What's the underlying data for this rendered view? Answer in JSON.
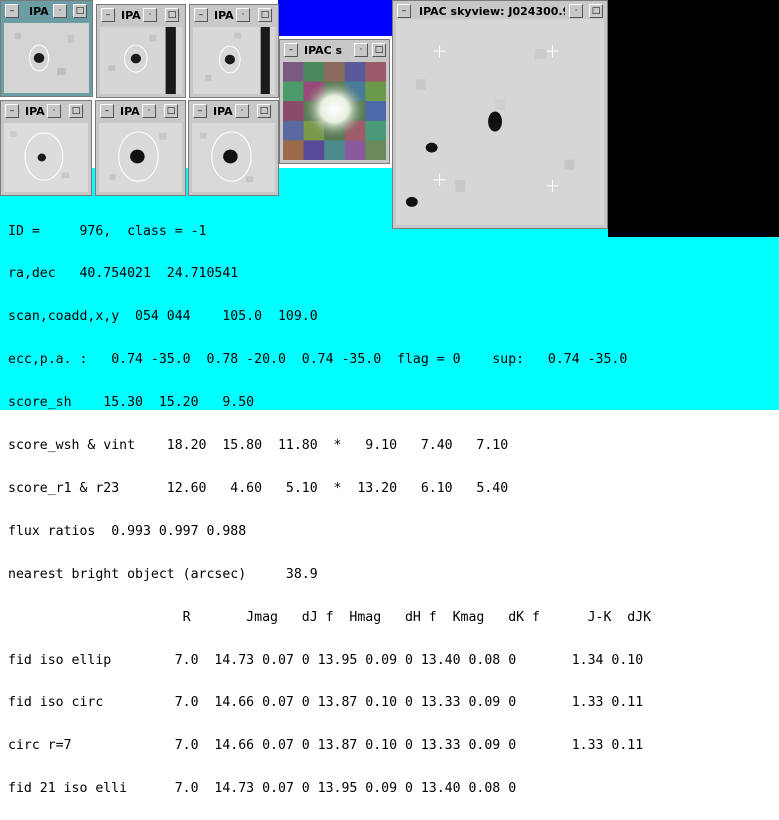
{
  "windows": {
    "thumb1_title": "IPA",
    "thumb2_title": "IPA",
    "thumb3_title": "IPA",
    "thumb4_title": "IPA",
    "thumb5_title": "IPA",
    "thumb6_title": "IPA",
    "color_title": "IPAC s",
    "skyview_title": "IPAC skyview: J024300.9"
  },
  "output": {
    "lines": [
      "ID =     976,  class = -1",
      "ra,dec   40.754021  24.710541",
      "scan,coadd,x,y  054 044    105.0  109.0",
      "ecc,p.a. :   0.74 -35.0  0.78 -20.0  0.74 -35.0  flag = 0    sup:   0.74 -35.0",
      "score_sh    15.30  15.20   9.50",
      "score_wsh & vint    18.20  15.80  11.80  *   9.10   7.40   7.10",
      "score_r1 & r23      12.60   4.60   5.10  *  13.20   6.10   5.40",
      "flux ratios  0.993 0.997 0.988",
      "nearest bright object (arcsec)     38.9",
      "                      R       Jmag   dJ f  Hmag   dH f  Kmag   dK f      J-K  dJK",
      "fid iso ellip        7.0  14.73 0.07 0 13.95 0.09 0 13.40 0.08 0       1.34 0.10",
      "fid iso circ         7.0  14.66 0.07 0 13.87 0.10 0 13.33 0.09 0       1.33 0.11",
      "circ r=7             7.0  14.66 0.07 0 13.87 0.10 0 13.33 0.09 0       1.33 0.11",
      "fid 21 iso elli      7.0  14.73 0.07 0 13.95 0.09 0 13.40 0.08 0"
    ]
  },
  "colors": {
    "terminal_bg": "#00ffff",
    "desktop_blue": "#0000ff",
    "active_frame": "#6a9ea4",
    "frame": "#c8c8c8"
  },
  "icons": [
    "window-menu-icon",
    "minimize-icon",
    "maximize-icon"
  ]
}
